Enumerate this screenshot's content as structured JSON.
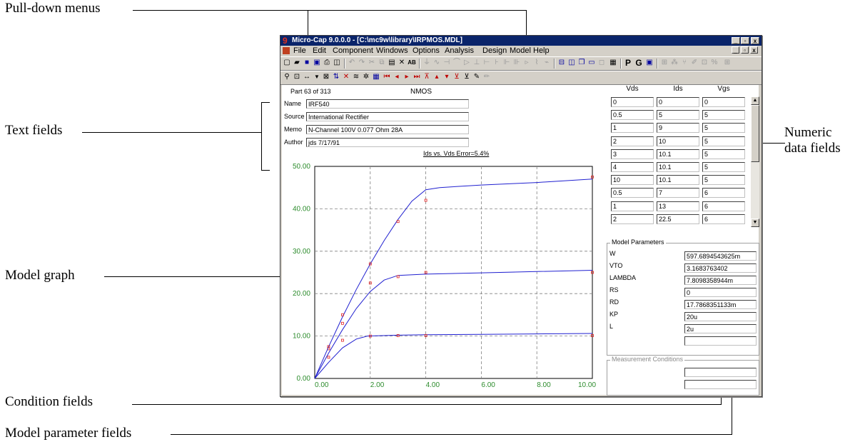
{
  "callouts": {
    "pulldown": "Pull-down menus",
    "text_fields": "Text fields",
    "numeric_1": "Numeric",
    "numeric_2": "data fields",
    "model_graph": "Model graph",
    "condition_fields": "Condition fields",
    "model_param_fields": "Model parameter fields"
  },
  "window": {
    "title": "Micro-Cap 9.0.0.0 - [C:\\mc9w\\library\\IRPMOS.MDL]",
    "app_icon": "9",
    "minimize": "_",
    "restore": "▫",
    "close": "x"
  },
  "menu": {
    "file": "File",
    "edit": "Edit",
    "component": "Component",
    "windows": "Windows",
    "options": "Options",
    "analysis": "Analysis",
    "design": "Design",
    "model": "Model",
    "help": "Help"
  },
  "toolbar2": {
    "p_label": "P",
    "g_label": "G"
  },
  "part": {
    "counter": "Part 63 of 313",
    "type": "NMOS"
  },
  "text_fields": {
    "name_label": "Name",
    "name_value": "IRF540",
    "source_label": "Source",
    "source_value": "International Rectifier",
    "memo_label": "Memo",
    "memo_value": "N-Channel 100V 0.077 Ohm 28A",
    "author_label": "Author",
    "author_value": "jds 7/17/91"
  },
  "numeric": {
    "headers": [
      "Vds",
      "Ids",
      "Vgs"
    ],
    "rows": [
      [
        "0",
        "0",
        "0"
      ],
      [
        "0.5",
        "5",
        "5"
      ],
      [
        "1",
        "9",
        "5"
      ],
      [
        "2",
        "10",
        "5"
      ],
      [
        "3",
        "10.1",
        "5"
      ],
      [
        "4",
        "10.1",
        "5"
      ],
      [
        "10",
        "10.1",
        "5"
      ],
      [
        "0.5",
        "7",
        "6"
      ],
      [
        "1",
        "13",
        "6"
      ],
      [
        "2",
        "22.5",
        "6"
      ]
    ]
  },
  "model_params": {
    "title": "Model Parameters",
    "items": [
      {
        "label": "W",
        "value": "597.6894543625m"
      },
      {
        "label": "VTO",
        "value": "3.1683763402"
      },
      {
        "label": "LAMBDA",
        "value": "7.8098358944m"
      },
      {
        "label": "RS",
        "value": "0"
      },
      {
        "label": "RD",
        "value": "17.7868351133m"
      },
      {
        "label": "KP",
        "value": "20u"
      },
      {
        "label": "L",
        "value": "2u"
      },
      {
        "label": "",
        "value": ""
      }
    ]
  },
  "measurement": {
    "title": "Measurement Conditions",
    "values": [
      "",
      ""
    ]
  },
  "chart_data": {
    "type": "line",
    "title": "Ids vs. Vds Error=5.4%",
    "xlabel": "",
    "ylabel": "",
    "xlim": [
      0,
      10
    ],
    "ylim": [
      0,
      50
    ],
    "x_ticks": [
      "0.00",
      "2.00",
      "4.00",
      "6.00",
      "8.00",
      "10.00"
    ],
    "y_ticks": [
      "0.00",
      "10.00",
      "20.00",
      "30.00",
      "40.00",
      "50.00"
    ],
    "grid": true,
    "colors": {
      "curve": "#2020d0",
      "points": "#e02020",
      "tick_labels": "#2d8c2d"
    },
    "series": [
      {
        "curve": [
          [
            0,
            0
          ],
          [
            0.5,
            3.8
          ],
          [
            1,
            7.2
          ],
          [
            1.5,
            9.3
          ],
          [
            1.9,
            10.0
          ],
          [
            3,
            10.2
          ],
          [
            4,
            10.3
          ],
          [
            6,
            10.4
          ],
          [
            8,
            10.5
          ],
          [
            10,
            10.6
          ]
        ],
        "points": [
          [
            0.5,
            5
          ],
          [
            1,
            9
          ],
          [
            2,
            10
          ],
          [
            3,
            10.1
          ],
          [
            4,
            10.1
          ],
          [
            10,
            10.1
          ]
        ]
      },
      {
        "curve": [
          [
            0,
            0
          ],
          [
            0.5,
            6
          ],
          [
            1,
            11.5
          ],
          [
            1.5,
            16.5
          ],
          [
            2,
            20.5
          ],
          [
            2.5,
            23.2
          ],
          [
            3,
            24.3
          ],
          [
            4,
            24.6
          ],
          [
            6,
            24.9
          ],
          [
            8,
            25.2
          ],
          [
            10,
            25.5
          ]
        ],
        "points": [
          [
            0.5,
            7
          ],
          [
            1,
            13
          ],
          [
            2,
            22.5
          ],
          [
            3,
            24
          ],
          [
            4,
            25
          ],
          [
            10,
            25
          ]
        ]
      },
      {
        "curve": [
          [
            0,
            0
          ],
          [
            0.5,
            7.5
          ],
          [
            1,
            14.5
          ],
          [
            1.5,
            21
          ],
          [
            2,
            27
          ],
          [
            2.5,
            32.5
          ],
          [
            3,
            37.5
          ],
          [
            3.5,
            41.8
          ],
          [
            4,
            44.5
          ],
          [
            4.5,
            45
          ],
          [
            6,
            45.6
          ],
          [
            8,
            46.2
          ],
          [
            10,
            47
          ]
        ],
        "points": [
          [
            0.5,
            7.5
          ],
          [
            1,
            15
          ],
          [
            2,
            27
          ],
          [
            3,
            37
          ],
          [
            4,
            42
          ],
          [
            10,
            47.5
          ]
        ]
      }
    ]
  }
}
